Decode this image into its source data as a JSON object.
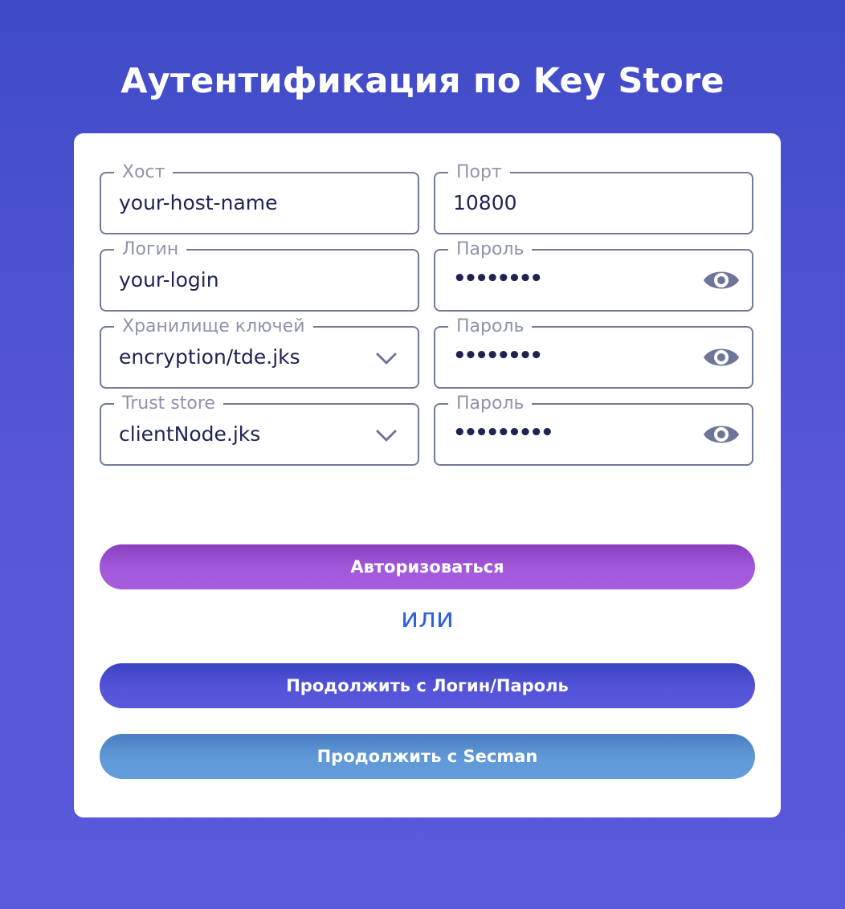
{
  "title": "Аутентификация по Key Store",
  "form": {
    "host": {
      "label": "Хост",
      "value": "your-host-name"
    },
    "port": {
      "label": "Порт",
      "value": "10800"
    },
    "login": {
      "label": "Логин",
      "value": "your-login"
    },
    "password": {
      "label": "Пароль",
      "value": "••••••••"
    },
    "keystore": {
      "label": "Хранилище ключей",
      "value": "encryption/tde.jks"
    },
    "keystore_password": {
      "label": "Пароль",
      "value": "••••••••"
    },
    "truststore": {
      "label": "Trust store",
      "value": "clientNode.jks"
    },
    "truststore_password": {
      "label": "Пароль",
      "value": "•••••••••"
    }
  },
  "buttons": {
    "authorize": "Авторизоваться",
    "or": "или",
    "continue_login": "Продолжить с Логин/Пароль",
    "continue_secman": "Продолжить с Secman"
  },
  "icons": {
    "eye": "eye-icon",
    "chevron": "chevron-down-icon"
  },
  "colors": {
    "background": "#4f52d2",
    "card": "#ffffff",
    "authorize_button": "#a259dc",
    "login_button": "#5553d8",
    "secman_button": "#6099d7",
    "or_text": "#2f62d8",
    "field_border": "#727a98"
  }
}
